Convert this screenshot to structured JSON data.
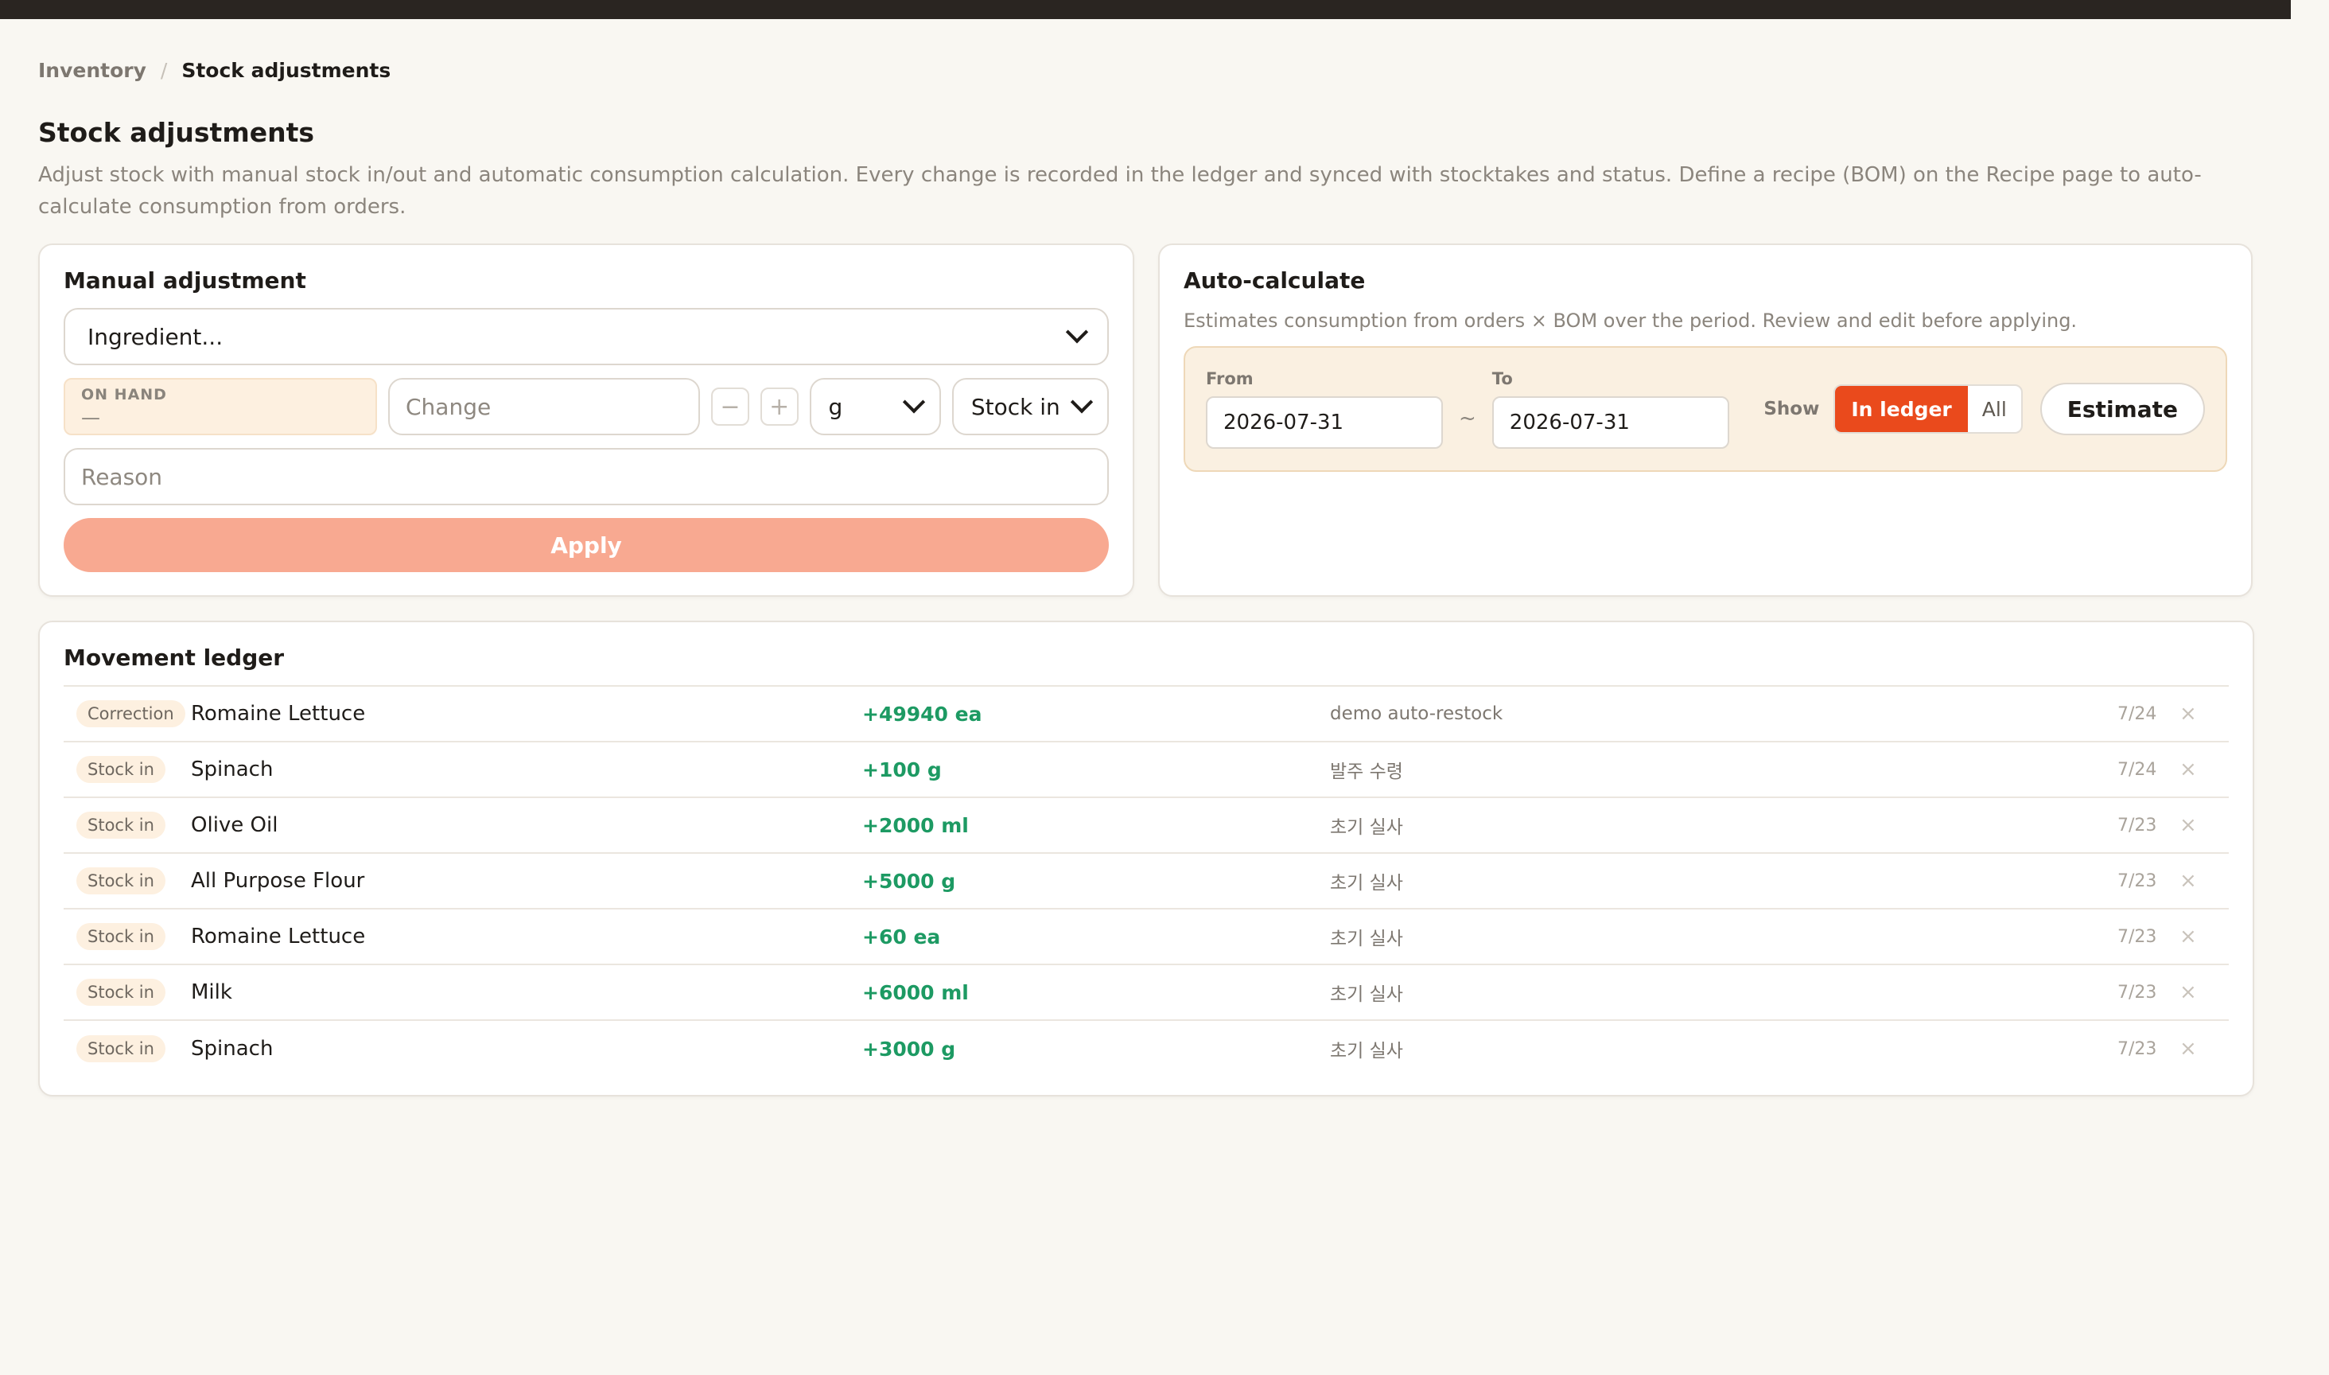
{
  "breadcrumb": {
    "parent": "Inventory",
    "separator": "/",
    "current": "Stock adjustments"
  },
  "page": {
    "title": "Stock adjustments",
    "description": "Adjust stock with manual stock in/out and automatic consumption calculation. Every change is recorded in the ledger and synced with stocktakes and status. Define a recipe (BOM) on the Recipe page to auto-calculate consumption from orders."
  },
  "manual": {
    "title": "Manual adjustment",
    "ingredient_placeholder": "Ingredient...",
    "on_hand_label": "ON HAND",
    "on_hand_value": "—",
    "change_placeholder": "Change",
    "minus": "−",
    "plus": "+",
    "unit_value": "g",
    "direction_value": "Stock in",
    "reason_placeholder": "Reason",
    "apply_label": "Apply"
  },
  "auto": {
    "title": "Auto-calculate",
    "description": "Estimates consumption from orders × BOM over the period. Review and edit before applying.",
    "from_label": "From",
    "from_value": "2026-07-31",
    "tilde": "~",
    "to_label": "To",
    "to_value": "2026-07-31",
    "show_label": "Show",
    "toggle_active": "In ledger",
    "toggle_inactive": "All",
    "estimate_label": "Estimate"
  },
  "ledger": {
    "title": "Movement ledger",
    "delete_glyph": "×",
    "rows": [
      {
        "type": "Correction",
        "item": "Romaine Lettuce",
        "qty": "+49940 ea",
        "note": "demo auto-restock",
        "date": "7/24"
      },
      {
        "type": "Stock in",
        "item": "Spinach",
        "qty": "+100 g",
        "note": "발주 수령",
        "date": "7/24"
      },
      {
        "type": "Stock in",
        "item": "Olive Oil",
        "qty": "+2000 ml",
        "note": "초기 실사",
        "date": "7/23"
      },
      {
        "type": "Stock in",
        "item": "All Purpose Flour",
        "qty": "+5000 g",
        "note": "초기 실사",
        "date": "7/23"
      },
      {
        "type": "Stock in",
        "item": "Romaine Lettuce",
        "qty": "+60 ea",
        "note": "초기 실사",
        "date": "7/23"
      },
      {
        "type": "Stock in",
        "item": "Milk",
        "qty": "+6000 ml",
        "note": "초기 실사",
        "date": "7/23"
      },
      {
        "type": "Stock in",
        "item": "Spinach",
        "qty": "+3000 g",
        "note": "초기 실사",
        "date": "7/23"
      }
    ]
  },
  "colors": {
    "accent": "#ea4a1c",
    "apply": "#f8a991",
    "positive": "#1d9a63",
    "background": "#f9f7f2"
  }
}
